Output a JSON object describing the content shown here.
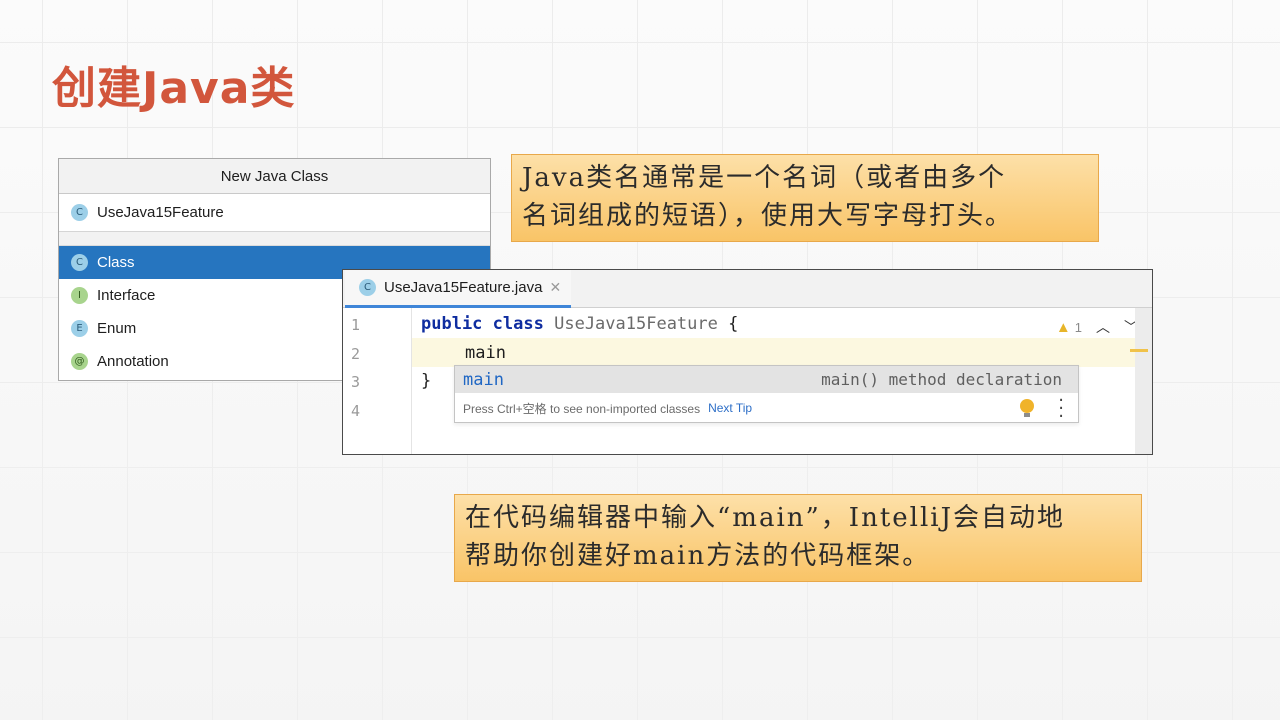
{
  "slide": {
    "title": "创建Java类"
  },
  "new_class_dialog": {
    "title": "New Java Class",
    "name_value": "UseJava15Feature",
    "kinds": [
      {
        "label": "Class",
        "icon": "C",
        "selected": true
      },
      {
        "label": "Interface",
        "icon": "I",
        "selected": false
      },
      {
        "label": "Enum",
        "icon": "E",
        "selected": false
      },
      {
        "label": "Annotation",
        "icon": "@",
        "selected": false
      }
    ]
  },
  "callouts": {
    "naming_line1": "Java类名通常是一个名词（或者由多个",
    "naming_line2": "名词组成的短语），使用大写字母打头。",
    "main_line1": "在代码编辑器中输入“main”，IntelliJ会自动地",
    "main_line2": "帮助你创建好main方法的代码框架。"
  },
  "editor": {
    "tab_label": "UseJava15Feature.java",
    "tab_icon": "C",
    "tab_close": "✕",
    "line_numbers": [
      "1",
      "2",
      "3",
      "4"
    ],
    "line1_kw1": "public",
    "line1_kw2": "class",
    "line1_name": "UseJava15Feature",
    "line1_brace": "{",
    "line2": "main",
    "line3": "}",
    "warning_count": "1"
  },
  "completion_popup": {
    "item": "main",
    "item_type": "main() method declaration",
    "hint": "Press Ctrl+空格 to see non-imported classes",
    "next_tip": "Next Tip"
  },
  "colors": {
    "title": "#d2563c",
    "selection": "#2675bf",
    "callout": "#f9c467",
    "keyword": "#0f2da0"
  }
}
